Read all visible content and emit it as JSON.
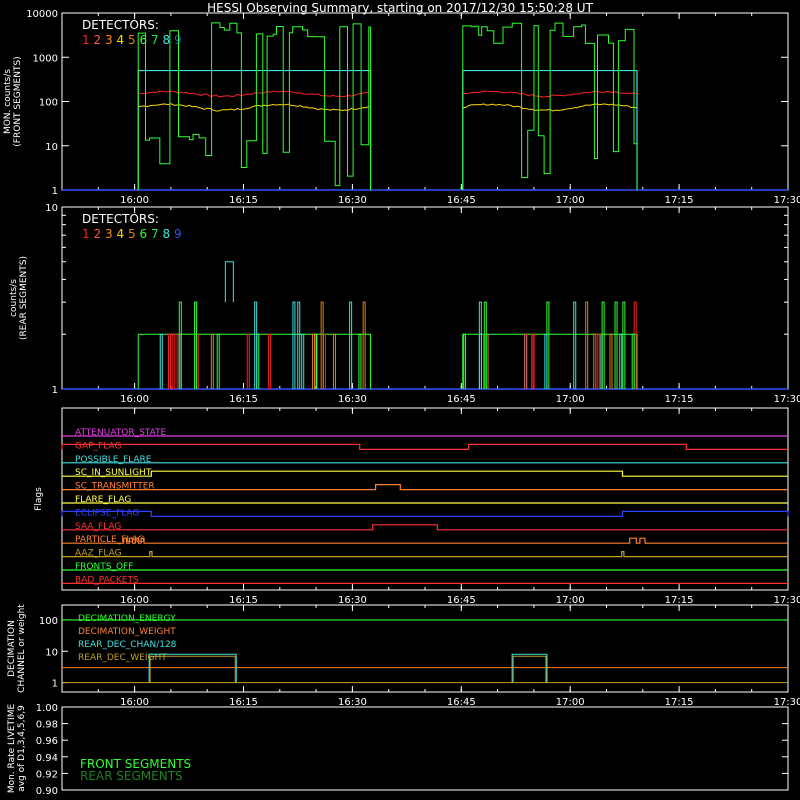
{
  "title": "HESSI Observing Summary, starting on 2017/12/30 15:50:28 UT",
  "time_axis": {
    "start_min": 950,
    "end_min": 1050,
    "ticks": [
      "16:00",
      "16:15",
      "16:30",
      "16:45",
      "17:00",
      "17:15",
      "17:30"
    ],
    "tick_minutes": [
      960,
      975,
      990,
      1005,
      1020,
      1035,
      1050
    ]
  },
  "colors": {
    "det1": "#ff2020",
    "det2": "#ff5050",
    "det3": "#ff8c00",
    "det4": "#ffd700",
    "det5": "#e08010",
    "det6": "#30ff30",
    "det7": "#20e060",
    "det8": "#40e0e0",
    "det9": "#3050ff"
  },
  "chart_data": [
    {
      "type": "line",
      "panel": "front",
      "ylabel": [
        "MON. counts/s",
        "(FRONT SEGMENTS)"
      ],
      "y_scale": "log",
      "ylim": [
        1,
        10000
      ],
      "y_ticks": [
        "1",
        "10",
        "100",
        "1000",
        "10000"
      ],
      "legend_title": "DETECTORS:",
      "legend": [
        "1",
        "2",
        "3",
        "4",
        "5",
        "6",
        "7",
        "8",
        "9"
      ],
      "intervals_on": [
        [
          960.5,
          992.5
        ],
        [
          1005.2,
          1029.2
        ]
      ],
      "series": [
        {
          "detector": "8",
          "level": 500
        },
        {
          "detector": "1",
          "level": 150
        },
        {
          "detector": "4",
          "level": 80
        },
        {
          "detector": "6",
          "level": 3000
        },
        {
          "detector": "9",
          "level": 1
        }
      ]
    },
    {
      "type": "line",
      "panel": "rear",
      "ylabel": [
        "counts/s",
        "(REAR SEGMENTS)"
      ],
      "y_scale": "log",
      "ylim": [
        1,
        10
      ],
      "y_ticks": [
        "1",
        "10"
      ],
      "legend_title": "DETECTORS:",
      "legend": [
        "1",
        "2",
        "3",
        "4",
        "5",
        "6",
        "7",
        "8",
        "9"
      ],
      "typical_level": 2,
      "peak_level": 5
    },
    {
      "type": "line",
      "panel": "flags",
      "ylabel": "Flags",
      "flags": [
        {
          "name": "ATTENUATOR_STATE",
          "color": "#e040e0",
          "on": []
        },
        {
          "name": "GAP_FLAG",
          "color": "#ff3030",
          "on": [
            [
              950,
              991
            ],
            [
              1006,
              1036
            ]
          ]
        },
        {
          "name": "POSSIBLE_FLARE",
          "color": "#40e0e0",
          "on": []
        },
        {
          "name": "SC_IN_SUNLIGHT",
          "color": "#ffff40",
          "on": [
            [
              962.3,
              1027.2
            ]
          ]
        },
        {
          "name": "SC_TRANSMITTER",
          "color": "#ff8030",
          "on": [
            [
              993.2,
              996.6
            ]
          ]
        },
        {
          "name": "FLARE_FLAG",
          "color": "#ffff40",
          "on": []
        },
        {
          "name": "ECLIPSE_FLAG",
          "color": "#3040ff",
          "on": [
            [
              950,
              962.3
            ],
            [
              1027.2,
              1050
            ]
          ]
        },
        {
          "name": "SAA_FLAG",
          "color": "#ff3030",
          "on": [
            [
              992.8,
              1001.7
            ]
          ]
        },
        {
          "name": "PARTICLE_FLAG",
          "color": "#ff8030",
          "on": [
            [
              958.5,
              958.9
            ],
            [
              959.3,
              959.7
            ],
            [
              960.1,
              960.5
            ],
            [
              960.9,
              961.3
            ],
            [
              1028.2,
              1029.1
            ],
            [
              1029.6,
              1030.3
            ]
          ]
        },
        {
          "name": "AAZ_FLAG",
          "color": "#c0a020",
          "on": [
            [
              962.1,
              962.4
            ],
            [
              1027.1,
              1027.4
            ]
          ]
        },
        {
          "name": "FRONTS_OFF",
          "color": "#30ff30",
          "on": []
        },
        {
          "name": "BAD_PACKETS",
          "color": "#ff3030",
          "on": []
        }
      ]
    },
    {
      "type": "line",
      "panel": "decimation",
      "ylabel": [
        "DECIMATION",
        "CHANNEL or weight"
      ],
      "y_scale": "log",
      "ylim": [
        0.5,
        300
      ],
      "y_ticks": [
        "1",
        "10",
        "100"
      ],
      "series": [
        {
          "name": "DECIMATION_ENERGY",
          "color": "#30ff30",
          "value": 100
        },
        {
          "name": "DECIMATION_WEIGHT",
          "color": "#ff8030",
          "value": 3
        },
        {
          "name": "REAR_DEC_CHAN/128",
          "color": "#40e0e0",
          "base": 1,
          "value": 8,
          "on": [
            [
              962,
              974
            ]
          ]
        },
        {
          "name": "REAR_DEC_WEIGHT",
          "color": "#c0a020",
          "value": 1
        }
      ],
      "rear_chan_on2": [
        [
          1012,
          1016.8
        ]
      ]
    },
    {
      "type": "line",
      "panel": "livetime",
      "ylabel": [
        "Mon. Rate LIVETIME",
        "avg of D1,3,4,5,6,9"
      ],
      "ylim": [
        0.9,
        1.0
      ],
      "y_ticks": [
        "0.90",
        "0.92",
        "0.94",
        "0.96",
        "0.98",
        "1.00"
      ],
      "legend": [
        {
          "name": "FRONT SEGMENTS",
          "color": "#30ff30"
        },
        {
          "name": "REAR SEGMENTS",
          "color": "#208020"
        }
      ]
    }
  ]
}
